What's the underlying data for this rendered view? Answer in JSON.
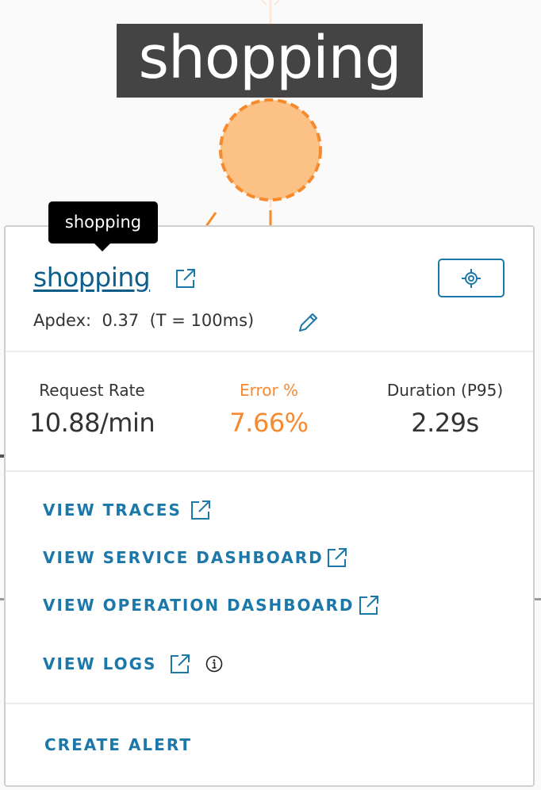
{
  "graph": {
    "node_label": "shopping",
    "node_color": "#fbc185",
    "node_border_color": "#f78a2c"
  },
  "tooltip": {
    "text": "shopping"
  },
  "card": {
    "service_name": "shopping",
    "service_link_icon": "external-link-icon",
    "locate_button_icon": "crosshair-icon",
    "apdex_label": "Apdex:",
    "apdex_value": "0.37",
    "apdex_threshold": "(T = 100ms)",
    "apdex_edit_icon": "pencil-icon",
    "metrics": [
      {
        "label": "Request Rate",
        "value": "10.88/min"
      },
      {
        "label": "Error %",
        "value": "7.66%",
        "color": "#f7892f"
      },
      {
        "label": "Duration (P95)",
        "value": "2.29s"
      }
    ],
    "actions": [
      {
        "label": "VIEW TRACES",
        "icon": "external-link-icon"
      },
      {
        "label": "VIEW SERVICE DASHBOARD",
        "icon": "external-link-icon"
      },
      {
        "label": "VIEW OPERATION DASHBOARD",
        "icon": "external-link-icon"
      },
      {
        "label": "VIEW LOGS",
        "icon": "external-link-icon",
        "extra_icon": "info-icon"
      }
    ],
    "create_alert_label": "CREATE ALERT"
  },
  "colors": {
    "link": "#1b78a8",
    "link_dark": "#0f5e8a",
    "error": "#f7892f"
  }
}
